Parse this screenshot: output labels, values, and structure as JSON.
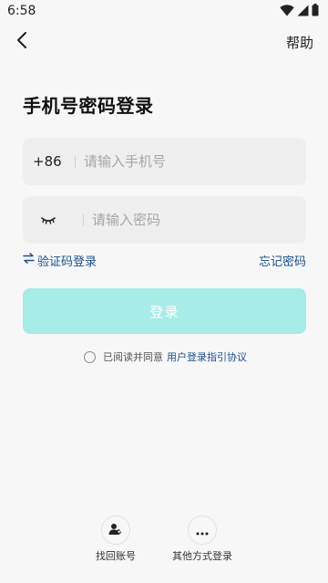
{
  "status_bar": {
    "time": "6:58",
    "icons": [
      "wifi-icon",
      "signal-icon",
      "battery-icon"
    ]
  },
  "header": {
    "back_icon": "chevron-left-icon",
    "help_label": "帮助"
  },
  "title": "手机号密码登录",
  "phone": {
    "country_code": "+86",
    "placeholder": "请输入手机号",
    "value": ""
  },
  "password": {
    "toggle_icon": "eye-closed-icon",
    "placeholder": "请输入密码",
    "value": ""
  },
  "links": {
    "switch_icon": "swap-icon",
    "sms_login": "验证码登录",
    "forgot_password": "忘记密码"
  },
  "login_button": {
    "label": "登录",
    "state": "disabled"
  },
  "agreement": {
    "text": "已阅读并同意",
    "link": "用户登录指引协议",
    "checked": false
  },
  "bottom": {
    "recover_account": {
      "label": "找回账号",
      "icon": "user-recover-icon"
    },
    "other_login": {
      "label": "其他方式登录",
      "icon": "more-dots-icon"
    }
  },
  "colors": {
    "background": "#f7f7f7",
    "field_bg": "#efefef",
    "link": "#1c4f8c",
    "login_button_disabled": "#a8ece8"
  }
}
